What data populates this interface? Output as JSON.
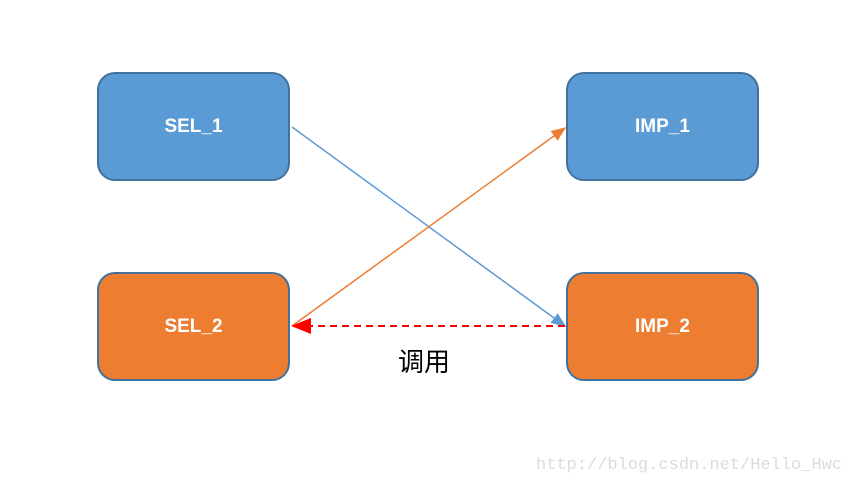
{
  "nodes": {
    "sel1": "SEL_1",
    "imp1": "IMP_1",
    "sel2": "SEL_2",
    "imp2": "IMP_2"
  },
  "call_label": "调用",
  "watermark": "http://blog.csdn.net/Hello_Hwc",
  "colors": {
    "blue": "#5b9bd5",
    "orange": "#ed7d31",
    "dashed": "#ff0000"
  }
}
